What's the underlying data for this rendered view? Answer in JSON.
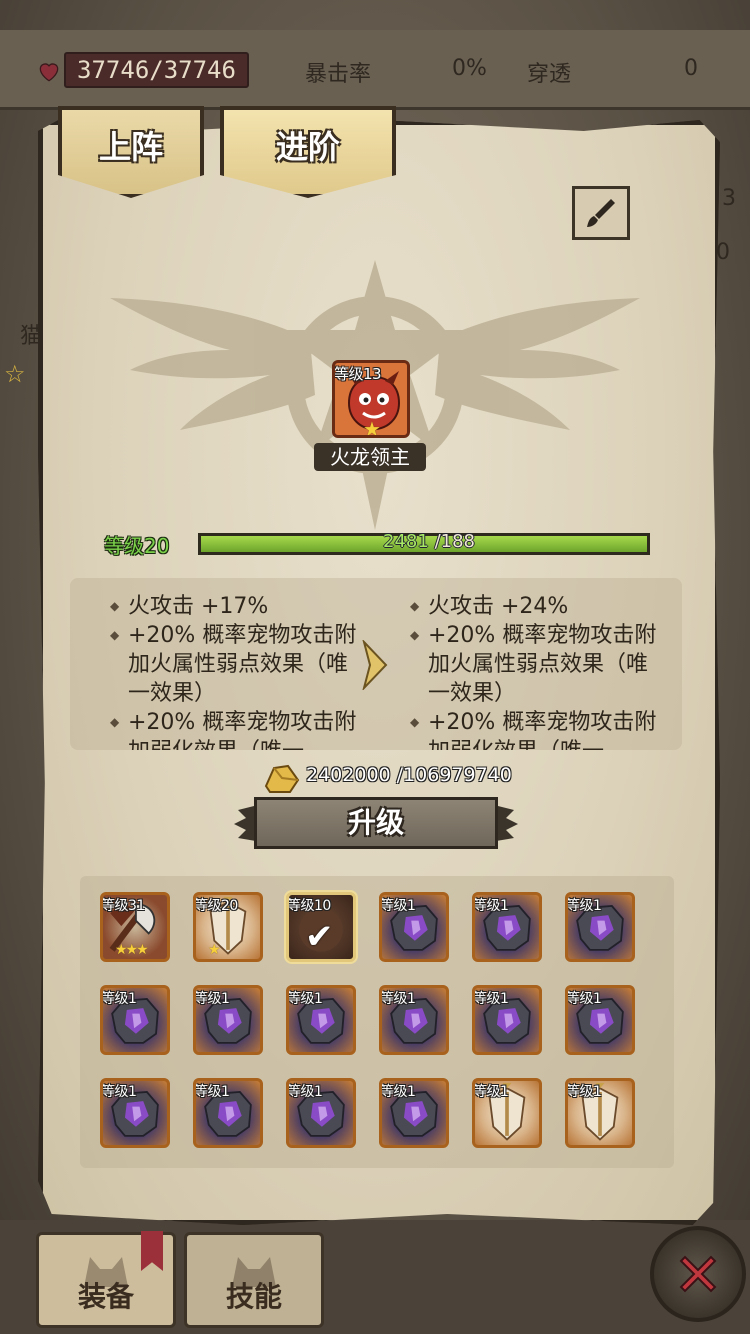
{
  "top_bar": {
    "hp": "37746/37746",
    "crit_label": "暴击率",
    "crit_value": "0%",
    "pierce_label": "穿透",
    "pierce_value": "0"
  },
  "side_peek": {
    "right_1": "3",
    "right_2": "0",
    "left_1": "猫"
  },
  "tabs": {
    "deploy": "上阵",
    "advance": "进阶"
  },
  "pet": {
    "level_text": "等级13",
    "name": "火龙领主",
    "stars": 1
  },
  "xp": {
    "level_text": "等级20",
    "current": "2481",
    "max": "/188",
    "fill_fraction": 1.0
  },
  "effects": {
    "current": [
      "火攻击  +17%",
      " +20% 概率宠物攻击附加火属性弱点效果（唯一效果）",
      " +20% 概率宠物攻击附加弱化效果（唯一"
    ],
    "next": [
      "火攻击  +24%",
      " +20% 概率宠物攻击附加火属性弱点效果（唯一效果）",
      " +20% 概率宠物攻击附加弱化效果（唯一"
    ]
  },
  "cost": {
    "text": "2402000 /106979740"
  },
  "upgrade_button": "升级",
  "materials": [
    {
      "level": "等级31",
      "kind": "axe",
      "stars": "★★★"
    },
    {
      "level": "等级20",
      "kind": "shield",
      "stars": "★"
    },
    {
      "level": "等级10",
      "kind": "selected",
      "stars": ""
    },
    {
      "level": "等级1",
      "kind": "stone",
      "stars": ""
    },
    {
      "level": "等级1",
      "kind": "stone",
      "stars": ""
    },
    {
      "level": "等级1",
      "kind": "stone",
      "stars": ""
    },
    {
      "level": "等级1",
      "kind": "stone",
      "stars": ""
    },
    {
      "level": "等级1",
      "kind": "stone",
      "stars": ""
    },
    {
      "level": "等级1",
      "kind": "stone",
      "stars": ""
    },
    {
      "level": "等级1",
      "kind": "stone",
      "stars": ""
    },
    {
      "level": "等级1",
      "kind": "stone",
      "stars": ""
    },
    {
      "level": "等级1",
      "kind": "stone",
      "stars": ""
    },
    {
      "level": "等级1",
      "kind": "stone",
      "stars": ""
    },
    {
      "level": "等级1",
      "kind": "stone",
      "stars": ""
    },
    {
      "level": "等级1",
      "kind": "stone",
      "stars": ""
    },
    {
      "level": "等级1",
      "kind": "stone",
      "stars": ""
    },
    {
      "level": "等级1",
      "kind": "shield",
      "stars": ""
    },
    {
      "level": "等级1",
      "kind": "shield",
      "stars": ""
    }
  ],
  "bottom_tabs": {
    "equip": "装备",
    "skill": "技能"
  }
}
